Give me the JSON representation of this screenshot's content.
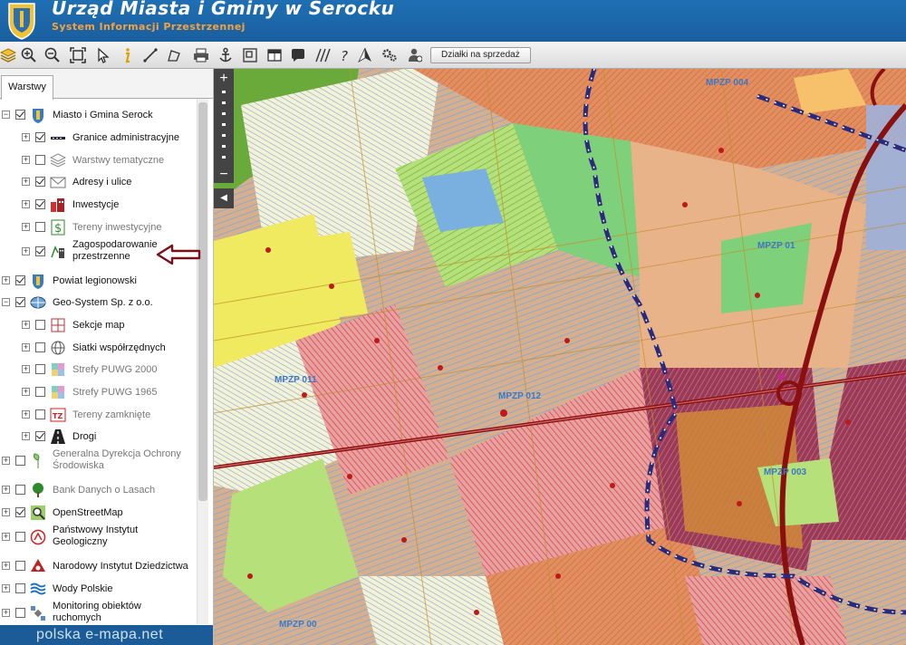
{
  "header": {
    "title": "Urząd Miasta i Gminy w Serocku",
    "subtitle": "System Informacji Przestrzennej"
  },
  "toolbar": {
    "tools": [
      "layers-icon",
      "zoom-in-icon",
      "zoom-out-icon",
      "zoom-extent-icon",
      "pointer-icon",
      "info-icon",
      "measure-distance-icon",
      "measure-area-icon",
      "print-icon",
      "anchor-icon",
      "overview-icon",
      "table-icon",
      "comment-icon",
      "hatch-icon",
      "help-icon",
      "north-icon",
      "settings-icon",
      "users-icon"
    ],
    "action_button": "Działki na sprzedaż"
  },
  "panel": {
    "tab_label": "Warstwy",
    "layers": [
      {
        "label": "Miasto i Gmina Serock",
        "checked": true,
        "expander": "minus",
        "icon": "crest-icon",
        "gray": false
      },
      {
        "label": "Granice administracyjne",
        "checked": true,
        "expander": "plus",
        "icon": "boundary-icon",
        "gray": false
      },
      {
        "label": "Warstwy tematyczne",
        "checked": false,
        "expander": "plus",
        "icon": "layers-stack-icon",
        "gray": true
      },
      {
        "label": "Adresy i ulice",
        "checked": true,
        "expander": "plus",
        "icon": "envelope-icon",
        "gray": false
      },
      {
        "label": "Inwestycje",
        "checked": true,
        "expander": "plus",
        "icon": "buildings-icon",
        "gray": false
      },
      {
        "label": "Tereny inwestycyjne",
        "checked": false,
        "expander": "plus",
        "icon": "dollar-icon",
        "gray": true
      },
      {
        "label": "Zagospodarowanie",
        "label2": "przestrzenne",
        "checked": true,
        "expander": "plus",
        "icon": "zoning-icon",
        "gray": false
      },
      {
        "label": "Powiat legionowski",
        "checked": true,
        "expander": "plus",
        "icon": "crest-icon",
        "gray": false
      },
      {
        "label": "Geo-System Sp. z o.o.",
        "checked": true,
        "expander": "minus",
        "icon": "globe-icon",
        "gray": false
      },
      {
        "label": "Sekcje map",
        "checked": false,
        "expander": "plus",
        "icon": "grid-icon",
        "gray": false
      },
      {
        "label": "Siatki współrzędnych",
        "checked": false,
        "expander": "plus",
        "icon": "globe-grid-icon",
        "gray": false
      },
      {
        "label": "Strefy PUWG 2000",
        "checked": false,
        "expander": "plus",
        "icon": "zones-icon",
        "gray": true
      },
      {
        "label": "Strefy PUWG 1965",
        "checked": false,
        "expander": "plus",
        "icon": "zones-icon",
        "gray": true
      },
      {
        "label": "Tereny zamknięte",
        "checked": false,
        "expander": "plus",
        "icon": "tz-icon",
        "gray": true
      },
      {
        "label": "Drogi",
        "checked": true,
        "expander": "plus",
        "icon": "road-icon",
        "gray": false
      },
      {
        "label": "Generalna Dyrekcja Ochrony",
        "label2": "Środowiska",
        "checked": false,
        "expander": "plus",
        "icon": "leaf-icon",
        "gray": true
      },
      {
        "label": "Bank Danych o Lasach",
        "checked": false,
        "expander": "plus",
        "icon": "tree-icon",
        "gray": true
      },
      {
        "label": "OpenStreetMap",
        "checked": true,
        "expander": "plus",
        "icon": "magnifier-icon",
        "gray": false
      },
      {
        "label": "Państwowy Instytut",
        "label2": "Geologiczny",
        "checked": false,
        "expander": "plus",
        "icon": "pig-icon",
        "gray": false
      },
      {
        "label": "Narodowy Instytut Dziedzictwa",
        "checked": false,
        "expander": "plus",
        "icon": "heritage-icon",
        "gray": false
      },
      {
        "label": "Wody Polskie",
        "checked": false,
        "expander": "plus",
        "icon": "water-icon",
        "gray": false
      },
      {
        "label": "Monitoring obiektów",
        "label2": "ruchomych",
        "checked": false,
        "expander": "plus",
        "icon": "satellite-icon",
        "gray": false
      }
    ],
    "footer": "polska e-mapa.net"
  },
  "map": {
    "zoom_in": "+",
    "zoom_out": "−",
    "collapse": "◀",
    "labels": [
      "MPZP 004",
      "MPZP 01",
      "MPZP 011",
      "MPZP 012",
      "MPZP 003",
      "MPZP 00"
    ]
  },
  "colors": {
    "header_bg": "#1a5f9f",
    "subtitle": "#f6a23a",
    "annotation_arrow": "#7a0f1a",
    "boundary": "#2a2a7a",
    "road": "#8a1010"
  }
}
